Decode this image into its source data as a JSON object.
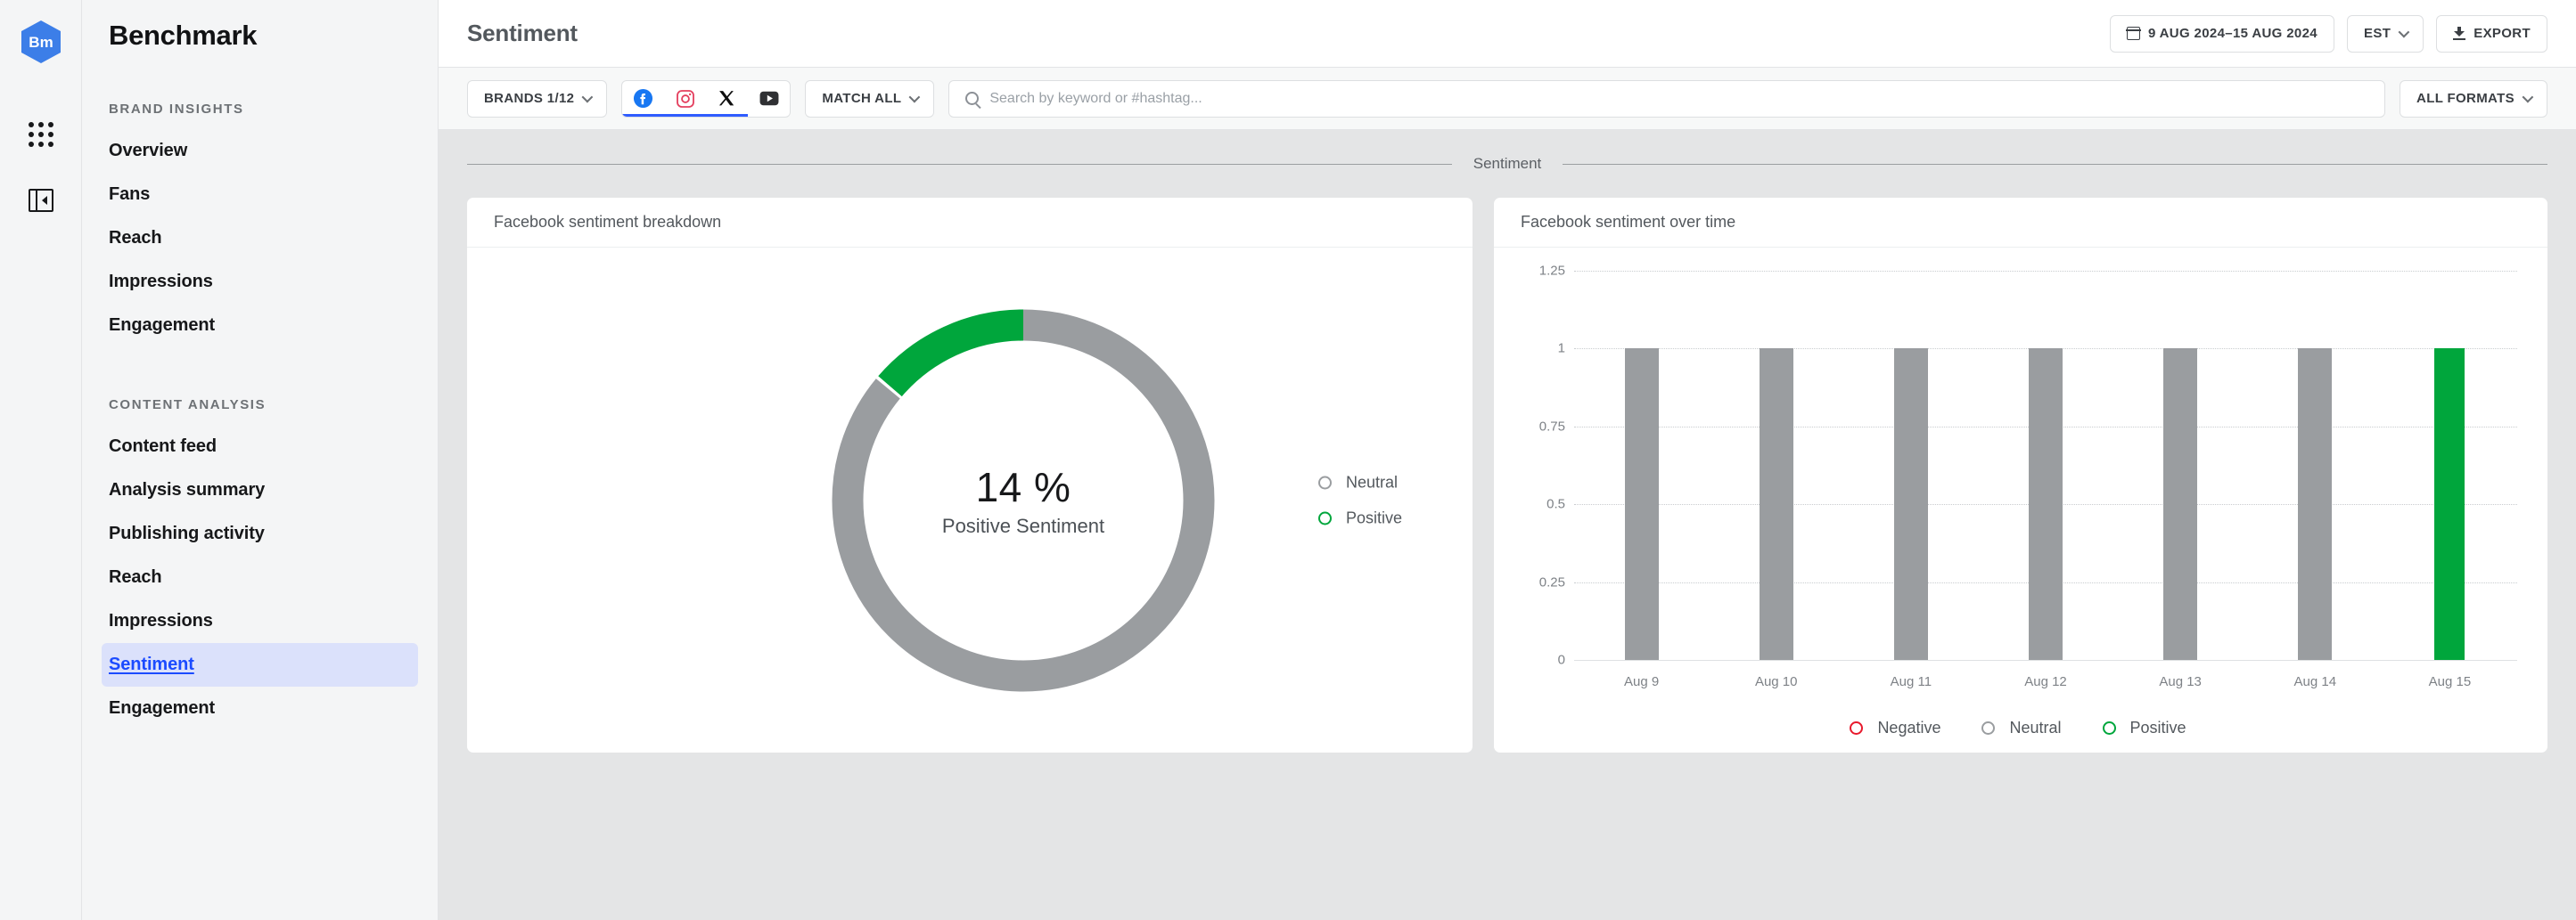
{
  "rail": {
    "logo_text": "Bm",
    "logo_color": "#3c7ee8",
    "apps_icon": "apps-grid-icon",
    "collapse_icon": "collapse-panel-icon"
  },
  "sidebar": {
    "brand": "Benchmark",
    "groups": [
      {
        "title": "BRAND INSIGHTS",
        "items": [
          {
            "label": "Overview",
            "active": false
          },
          {
            "label": "Fans",
            "active": false
          },
          {
            "label": "Reach",
            "active": false
          },
          {
            "label": "Impressions",
            "active": false
          },
          {
            "label": "Engagement",
            "active": false
          }
        ]
      },
      {
        "title": "CONTENT ANALYSIS",
        "items": [
          {
            "label": "Content feed",
            "active": false
          },
          {
            "label": "Analysis summary",
            "active": false
          },
          {
            "label": "Publishing activity",
            "active": false
          },
          {
            "label": "Reach",
            "active": false
          },
          {
            "label": "Impressions",
            "active": false
          },
          {
            "label": "Sentiment",
            "active": true
          },
          {
            "label": "Engagement",
            "active": false
          }
        ]
      }
    ],
    "active_color": "#1b4bff",
    "active_bg": "#dbe1fb"
  },
  "topbar": {
    "page_title": "Sentiment",
    "date_range": "9 AUG 2024–15 AUG 2024",
    "timezone": "EST",
    "export_label": "EXPORT"
  },
  "filterbar": {
    "brands_label": "BRANDS 1/12",
    "networks": [
      {
        "name": "facebook",
        "selected": true
      },
      {
        "name": "instagram",
        "selected": true
      },
      {
        "name": "x-twitter",
        "selected": true
      },
      {
        "name": "youtube",
        "selected": false
      }
    ],
    "match_label": "MATCH ALL",
    "search_placeholder": "Search by keyword or #hashtag...",
    "search_value": "",
    "formats_label": "ALL FORMATS",
    "selected_underline_color": "#2f5cff"
  },
  "section": {
    "label": "Sentiment"
  },
  "donut_card": {
    "title": "Facebook sentiment breakdown"
  },
  "bar_card": {
    "title": "Facebook sentiment over time"
  },
  "chart_data": [
    {
      "type": "pie",
      "title": "Facebook sentiment breakdown",
      "variant": "donut",
      "center_value": "14 %",
      "center_label": "Positive Sentiment",
      "categories": [
        "Positive",
        "Neutral"
      ],
      "values": [
        14,
        86
      ],
      "colors": [
        "#00a63c",
        "#9a9da0"
      ],
      "legend": [
        {
          "label": "Neutral",
          "color": "#9a9da0"
        },
        {
          "label": "Positive",
          "color": "#00a63c"
        }
      ],
      "legend_position": "right"
    },
    {
      "type": "bar",
      "title": "Facebook sentiment over time",
      "categories": [
        "Aug 9",
        "Aug 10",
        "Aug 11",
        "Aug 12",
        "Aug 13",
        "Aug 14",
        "Aug 15"
      ],
      "values": [
        1,
        1,
        1,
        1,
        1,
        1,
        1
      ],
      "bar_colors": [
        "#9a9da0",
        "#9a9da0",
        "#9a9da0",
        "#9a9da0",
        "#9a9da0",
        "#9a9da0",
        "#00a63c"
      ],
      "bar_sentiments": [
        "Neutral",
        "Neutral",
        "Neutral",
        "Neutral",
        "Neutral",
        "Neutral",
        "Positive"
      ],
      "ylim": [
        0,
        1.25
      ],
      "yticks": [
        "0",
        "0.25",
        "0.5",
        "0.75",
        "1",
        "1.25"
      ],
      "ytick_values": [
        0,
        0.25,
        0.5,
        0.75,
        1,
        1.25
      ],
      "xlabel": "",
      "ylabel": "",
      "grid": true,
      "legend": [
        {
          "label": "Negative",
          "color": "#e8192c"
        },
        {
          "label": "Neutral",
          "color": "#9a9da0"
        },
        {
          "label": "Positive",
          "color": "#00a63c"
        }
      ],
      "legend_position": "bottom"
    }
  ]
}
